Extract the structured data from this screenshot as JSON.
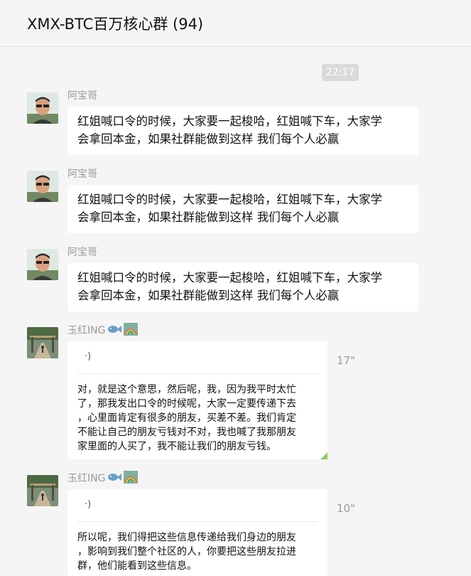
{
  "header": {
    "title": "XMX-BTC百万核心群 (94)"
  },
  "timestamp": "22:17",
  "messages": [
    {
      "sender": "阿宝哥",
      "type": "text",
      "line1": "红姐喊口令的时候，大家要一起梭哈，红姐喊下车，大家学",
      "line2": "会拿回本金，如果社群能做到这样 我们每个人必赢"
    },
    {
      "sender": "阿宝哥",
      "type": "text",
      "line1": "红姐喊口令的时候，大家要一起梭哈，红姐喊下车，大家学",
      "line2": "会拿回本金，如果社群能做到这样 我们每个人必赢"
    },
    {
      "sender": "阿宝哥",
      "type": "text",
      "line1": "红姐喊口令的时候，大家要一起梭哈，红姐喊下车，大家学",
      "line2": "会拿回本金，如果社群能做到这样 我们每个人必赢"
    },
    {
      "sender": "玉红ING",
      "type": "voice",
      "duration": "17\"",
      "voice_symbol": "·)",
      "lines": [
        "对，就是这个意思，然后呢，我，因为我平时太忙",
        "了，那我发出口令的时候呢，大家一定要传递下去",
        "，心里面肯定有很多的朋友，买差不差。我们肯定",
        "不能让自己的朋友亏钱对不对，我也喊了我那朋友",
        "家里面的人买了，我不能让我们的朋友亏钱。"
      ]
    },
    {
      "sender": "玉红ING",
      "type": "voice",
      "duration": "10\"",
      "voice_symbol": "·)",
      "lines": [
        "所以呢，我们得把这些信息传递给我们身边的朋友",
        "，影响到我们整个社区的人，你要把这些朋友拉进",
        "群，他们能看到这些信息。"
      ]
    }
  ],
  "icons": {
    "fish": "fish-badge-icon",
    "rainbow": "rainbow-badge-icon"
  },
  "colors": {
    "background": "#f5f5f5",
    "bubble": "#ffffff",
    "sender": "#9a9a9a",
    "timestamp_bg": "#dadada"
  }
}
